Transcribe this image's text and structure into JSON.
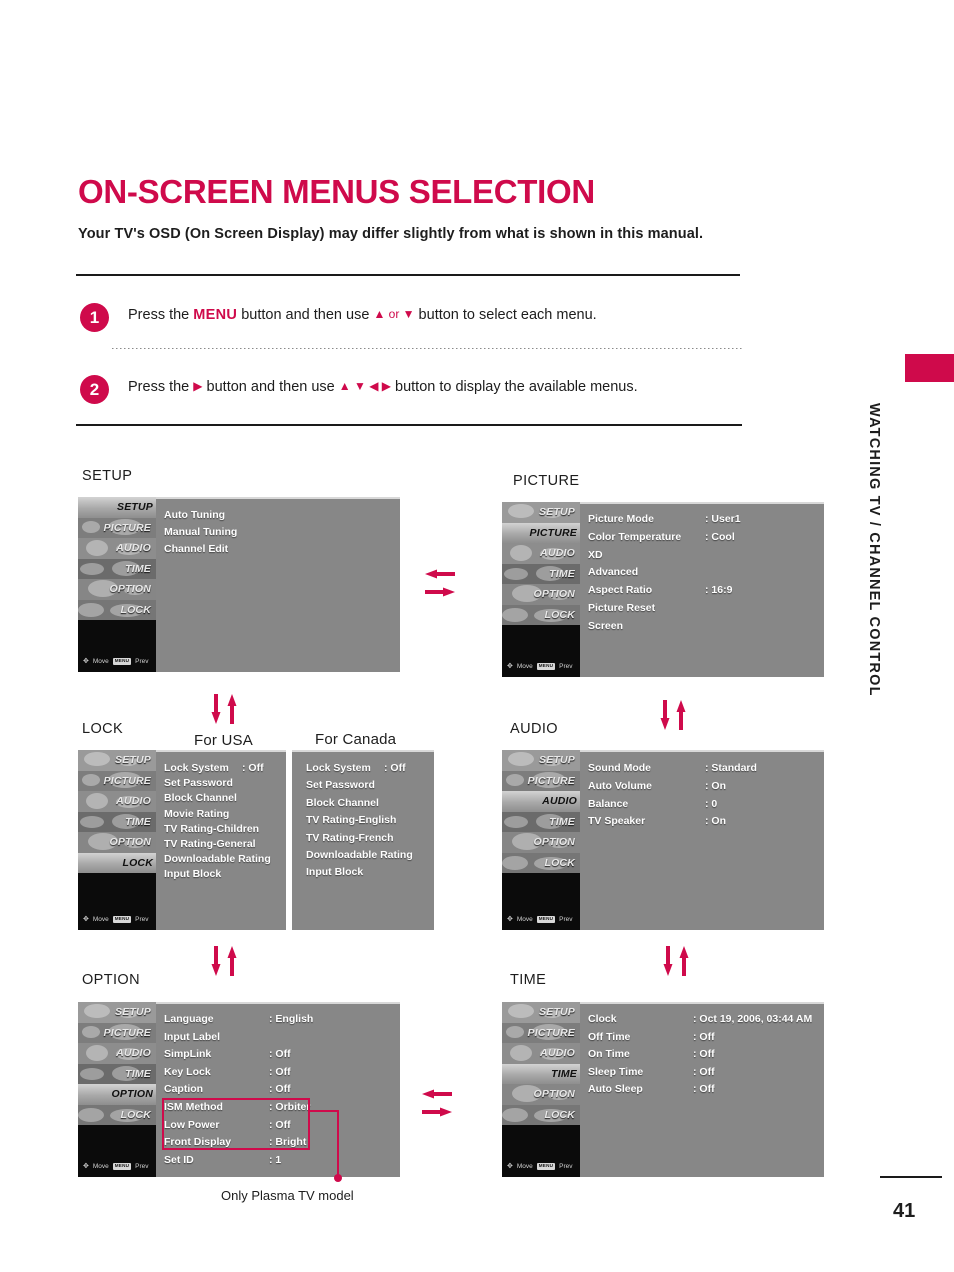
{
  "page": {
    "title": "ON-SCREEN MENUS SELECTION",
    "subtitle": "Your TV's OSD (On Screen Display) may differ slightly from what is shown in this manual.",
    "side_tab": "WATCHING TV / CHANNEL CONTROL",
    "page_number": "41",
    "accent_color": "#cf0a4b"
  },
  "steps": [
    {
      "num": "1",
      "pre": "Press the ",
      "keyword": "MENU",
      "mid": " button and then use ",
      "arrows": "▲ or ▼",
      "post": " button to select each menu."
    },
    {
      "num": "2",
      "pre": "Press the ",
      "keyword": "▶",
      "mid": " button and then use ",
      "arrows": "▲ ▼ ◀ ▶",
      "post": " button to display the available menus."
    }
  ],
  "osd_common": {
    "sidebar": [
      "SETUP",
      "PICTURE",
      "AUDIO",
      "TIME",
      "OPTION",
      "LOCK"
    ],
    "footer_move": "Move",
    "footer_menu_badge": "MENU",
    "footer_prev": "Prev"
  },
  "panels": {
    "setup": {
      "caption": "SETUP",
      "active": "SETUP",
      "rows": [
        {
          "key": "Auto Tuning",
          "value": ""
        },
        {
          "key": "Manual Tuning",
          "value": ""
        },
        {
          "key": "Channel Edit",
          "value": ""
        }
      ]
    },
    "picture": {
      "caption": "PICTURE",
      "active": "PICTURE",
      "rows": [
        {
          "key": "Picture Mode",
          "value": ": User1"
        },
        {
          "key": "Color Temperature",
          "value": ": Cool"
        },
        {
          "key": "XD",
          "value": ""
        },
        {
          "key": "Advanced",
          "value": ""
        },
        {
          "key": "Aspect Ratio",
          "value": ": 16:9"
        },
        {
          "key": "Picture Reset",
          "value": ""
        },
        {
          "key": "Screen",
          "value": ""
        }
      ]
    },
    "lock_usa": {
      "caption": "LOCK",
      "column_label": "For USA",
      "active": "LOCK",
      "rows": [
        {
          "key": "Lock System",
          "value": ": Off"
        },
        {
          "key": "Set Password",
          "value": ""
        },
        {
          "key": "Block Channel",
          "value": ""
        },
        {
          "key": "Movie Rating",
          "value": ""
        },
        {
          "key": "TV Rating-Children",
          "value": ""
        },
        {
          "key": "TV Rating-General",
          "value": ""
        },
        {
          "key": "Downloadable Rating",
          "value": ""
        },
        {
          "key": "Input Block",
          "value": ""
        }
      ]
    },
    "lock_canada": {
      "column_label": "For Canada",
      "rows": [
        {
          "key": "Lock System",
          "value": ": Off"
        },
        {
          "key": "Set Password",
          "value": ""
        },
        {
          "key": "Block Channel",
          "value": ""
        },
        {
          "key": "TV Rating-English",
          "value": ""
        },
        {
          "key": "TV Rating-French",
          "value": ""
        },
        {
          "key": "Downloadable Rating",
          "value": ""
        },
        {
          "key": "Input Block",
          "value": ""
        }
      ]
    },
    "audio": {
      "caption": "AUDIO",
      "active": "AUDIO",
      "rows": [
        {
          "key": "Sound Mode",
          "value": ": Standard"
        },
        {
          "key": "Auto Volume",
          "value": ": On"
        },
        {
          "key": "Balance",
          "value": ": 0"
        },
        {
          "key": "TV Speaker",
          "value": ": On"
        }
      ]
    },
    "option": {
      "caption": "OPTION",
      "active": "OPTION",
      "callout_note": "Only Plasma TV model",
      "rows": [
        {
          "key": "Language",
          "value": ": English"
        },
        {
          "key": "Input Label",
          "value": ""
        },
        {
          "key": "SimpLink",
          "value": ": Off"
        },
        {
          "key": "Key Lock",
          "value": ": Off"
        },
        {
          "key": "Caption",
          "value": ": Off"
        },
        {
          "key": "ISM Method",
          "value": ": Orbiter"
        },
        {
          "key": "Low Power",
          "value": ": Off"
        },
        {
          "key": "Front Display",
          "value": ": Bright"
        },
        {
          "key": "Set ID",
          "value": ": 1"
        }
      ]
    },
    "time": {
      "caption": "TIME",
      "active": "TIME",
      "rows": [
        {
          "key": "Clock",
          "value": ": Oct 19, 2006, 03:44 AM"
        },
        {
          "key": "Off Time",
          "value": ": Off"
        },
        {
          "key": "On Time",
          "value": ": Off"
        },
        {
          "key": "Sleep Time",
          "value": ": Off"
        },
        {
          "key": "Auto Sleep",
          "value": ": Off"
        }
      ]
    }
  }
}
